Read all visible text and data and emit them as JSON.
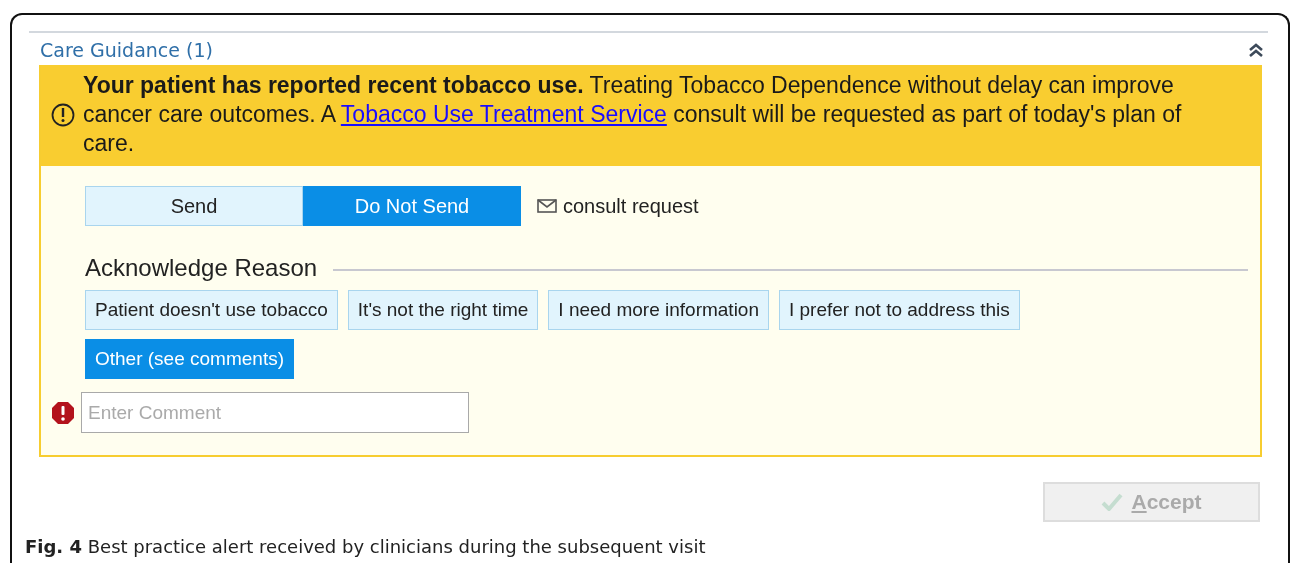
{
  "section": {
    "title": "Care Guidance (1)",
    "expanded": true
  },
  "alert": {
    "text_before": "**Your patient has reported recent tobacco use.** Treating Tobacco Dependence without delay can improve cancer care outcomes. A",
    "link": "Tobacco Use Treatment Service",
    "text_after": "consult will be requested as part of today's plan of care."
  },
  "send_options": [
    {
      "label": "Send",
      "selected": false
    },
    {
      "label": "Do Not Send",
      "selected": true
    }
  ],
  "order_label": "consult request",
  "reason_heading": "Acknowledge Reason",
  "reasons": [
    {
      "label": "Patient doesn't use tobacco",
      "selected": false
    },
    {
      "label": "It's not the right time",
      "selected": false
    },
    {
      "label": "I need more information",
      "selected": false
    },
    {
      "label": "I prefer not to address this",
      "selected": false
    },
    {
      "label": "Other (see comments)",
      "selected": true
    }
  ],
  "comment": {
    "placeholder": "Enter Comment",
    "required": true
  },
  "accept": {
    "label": "Accept",
    "disabled": true
  },
  "caption": "**Fig. 4** Best practice alert received by clinicians during the subsequent visit"
}
